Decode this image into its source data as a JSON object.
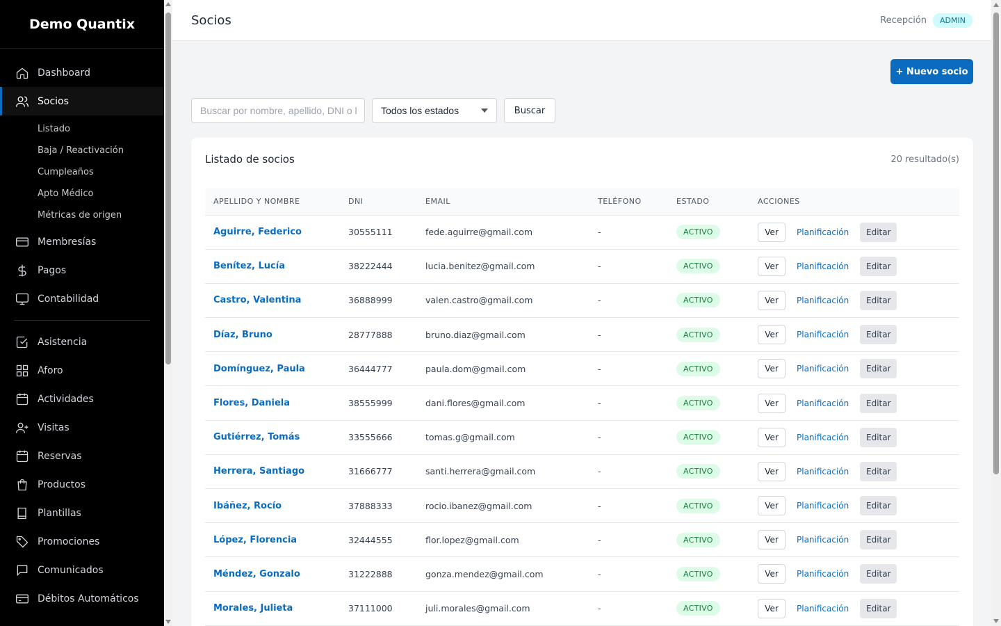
{
  "brand": "Demo Quantix",
  "nav": {
    "dashboard": "Dashboard",
    "socios": "Socios",
    "sub": [
      "Listado",
      "Baja / Reactivación",
      "Cumpleaños",
      "Apto Médico",
      "Métricas de origen"
    ],
    "membresias": "Membresías",
    "pagos": "Pagos",
    "contabilidad": "Contabilidad",
    "asistencia": "Asistencia",
    "aforo": "Aforo",
    "actividades": "Actividades",
    "visitas": "Visitas",
    "reservas": "Reservas",
    "productos": "Productos",
    "plantillas": "Plantillas",
    "promociones": "Promociones",
    "comunicados": "Comunicados",
    "debitos": "Débitos Automáticos"
  },
  "header": {
    "title": "Socios",
    "role_text": "Recepción",
    "role_badge": "ADMIN"
  },
  "toolbar": {
    "new_label": "+ Nuevo socio",
    "search_placeholder": "Buscar por nombre, apellido, DNI o l",
    "status_selected": "Todos los estados",
    "search_button": "Buscar"
  },
  "list": {
    "title": "Listado de socios",
    "count": "20 resultado(s)",
    "columns": [
      "APELLIDO Y NOMBRE",
      "DNI",
      "EMAIL",
      "TELÉFONO",
      "ESTADO",
      "ACCIONES"
    ],
    "action_labels": {
      "ver": "Ver",
      "plan": "Planificación",
      "edit": "Editar"
    },
    "rows": [
      {
        "name": "Aguirre, Federico",
        "dni": "30555111",
        "email": "fede.aguirre@gmail.com",
        "phone": "-",
        "status": "ACTIVO"
      },
      {
        "name": "Benítez, Lucía",
        "dni": "38222444",
        "email": "lucia.benitez@gmail.com",
        "phone": "-",
        "status": "ACTIVO"
      },
      {
        "name": "Castro, Valentina",
        "dni": "36888999",
        "email": "valen.castro@gmail.com",
        "phone": "-",
        "status": "ACTIVO"
      },
      {
        "name": "Díaz, Bruno",
        "dni": "28777888",
        "email": "bruno.diaz@gmail.com",
        "phone": "-",
        "status": "ACTIVO"
      },
      {
        "name": "Domínguez, Paula",
        "dni": "36444777",
        "email": "paula.dom@gmail.com",
        "phone": "-",
        "status": "ACTIVO"
      },
      {
        "name": "Flores, Daniela",
        "dni": "38555999",
        "email": "dani.flores@gmail.com",
        "phone": "-",
        "status": "ACTIVO"
      },
      {
        "name": "Gutiérrez, Tomás",
        "dni": "33555666",
        "email": "tomas.g@gmail.com",
        "phone": "-",
        "status": "ACTIVO"
      },
      {
        "name": "Herrera, Santiago",
        "dni": "31666777",
        "email": "santi.herrera@gmail.com",
        "phone": "-",
        "status": "ACTIVO"
      },
      {
        "name": "Ibáñez, Rocío",
        "dni": "37888333",
        "email": "rocio.ibanez@gmail.com",
        "phone": "-",
        "status": "ACTIVO"
      },
      {
        "name": "López, Florencia",
        "dni": "32444555",
        "email": "flor.lopez@gmail.com",
        "phone": "-",
        "status": "ACTIVO"
      },
      {
        "name": "Méndez, Gonzalo",
        "dni": "31222888",
        "email": "gonza.mendez@gmail.com",
        "phone": "-",
        "status": "ACTIVO"
      },
      {
        "name": "Morales, Julieta",
        "dni": "37111000",
        "email": "juli.morales@gmail.com",
        "phone": "-",
        "status": "ACTIVO"
      }
    ]
  },
  "colors": {
    "accent": "#0b6cbf",
    "status_bg": "#dcfce7",
    "status_fg": "#15803d",
    "sidebar_bg": "#000000"
  }
}
